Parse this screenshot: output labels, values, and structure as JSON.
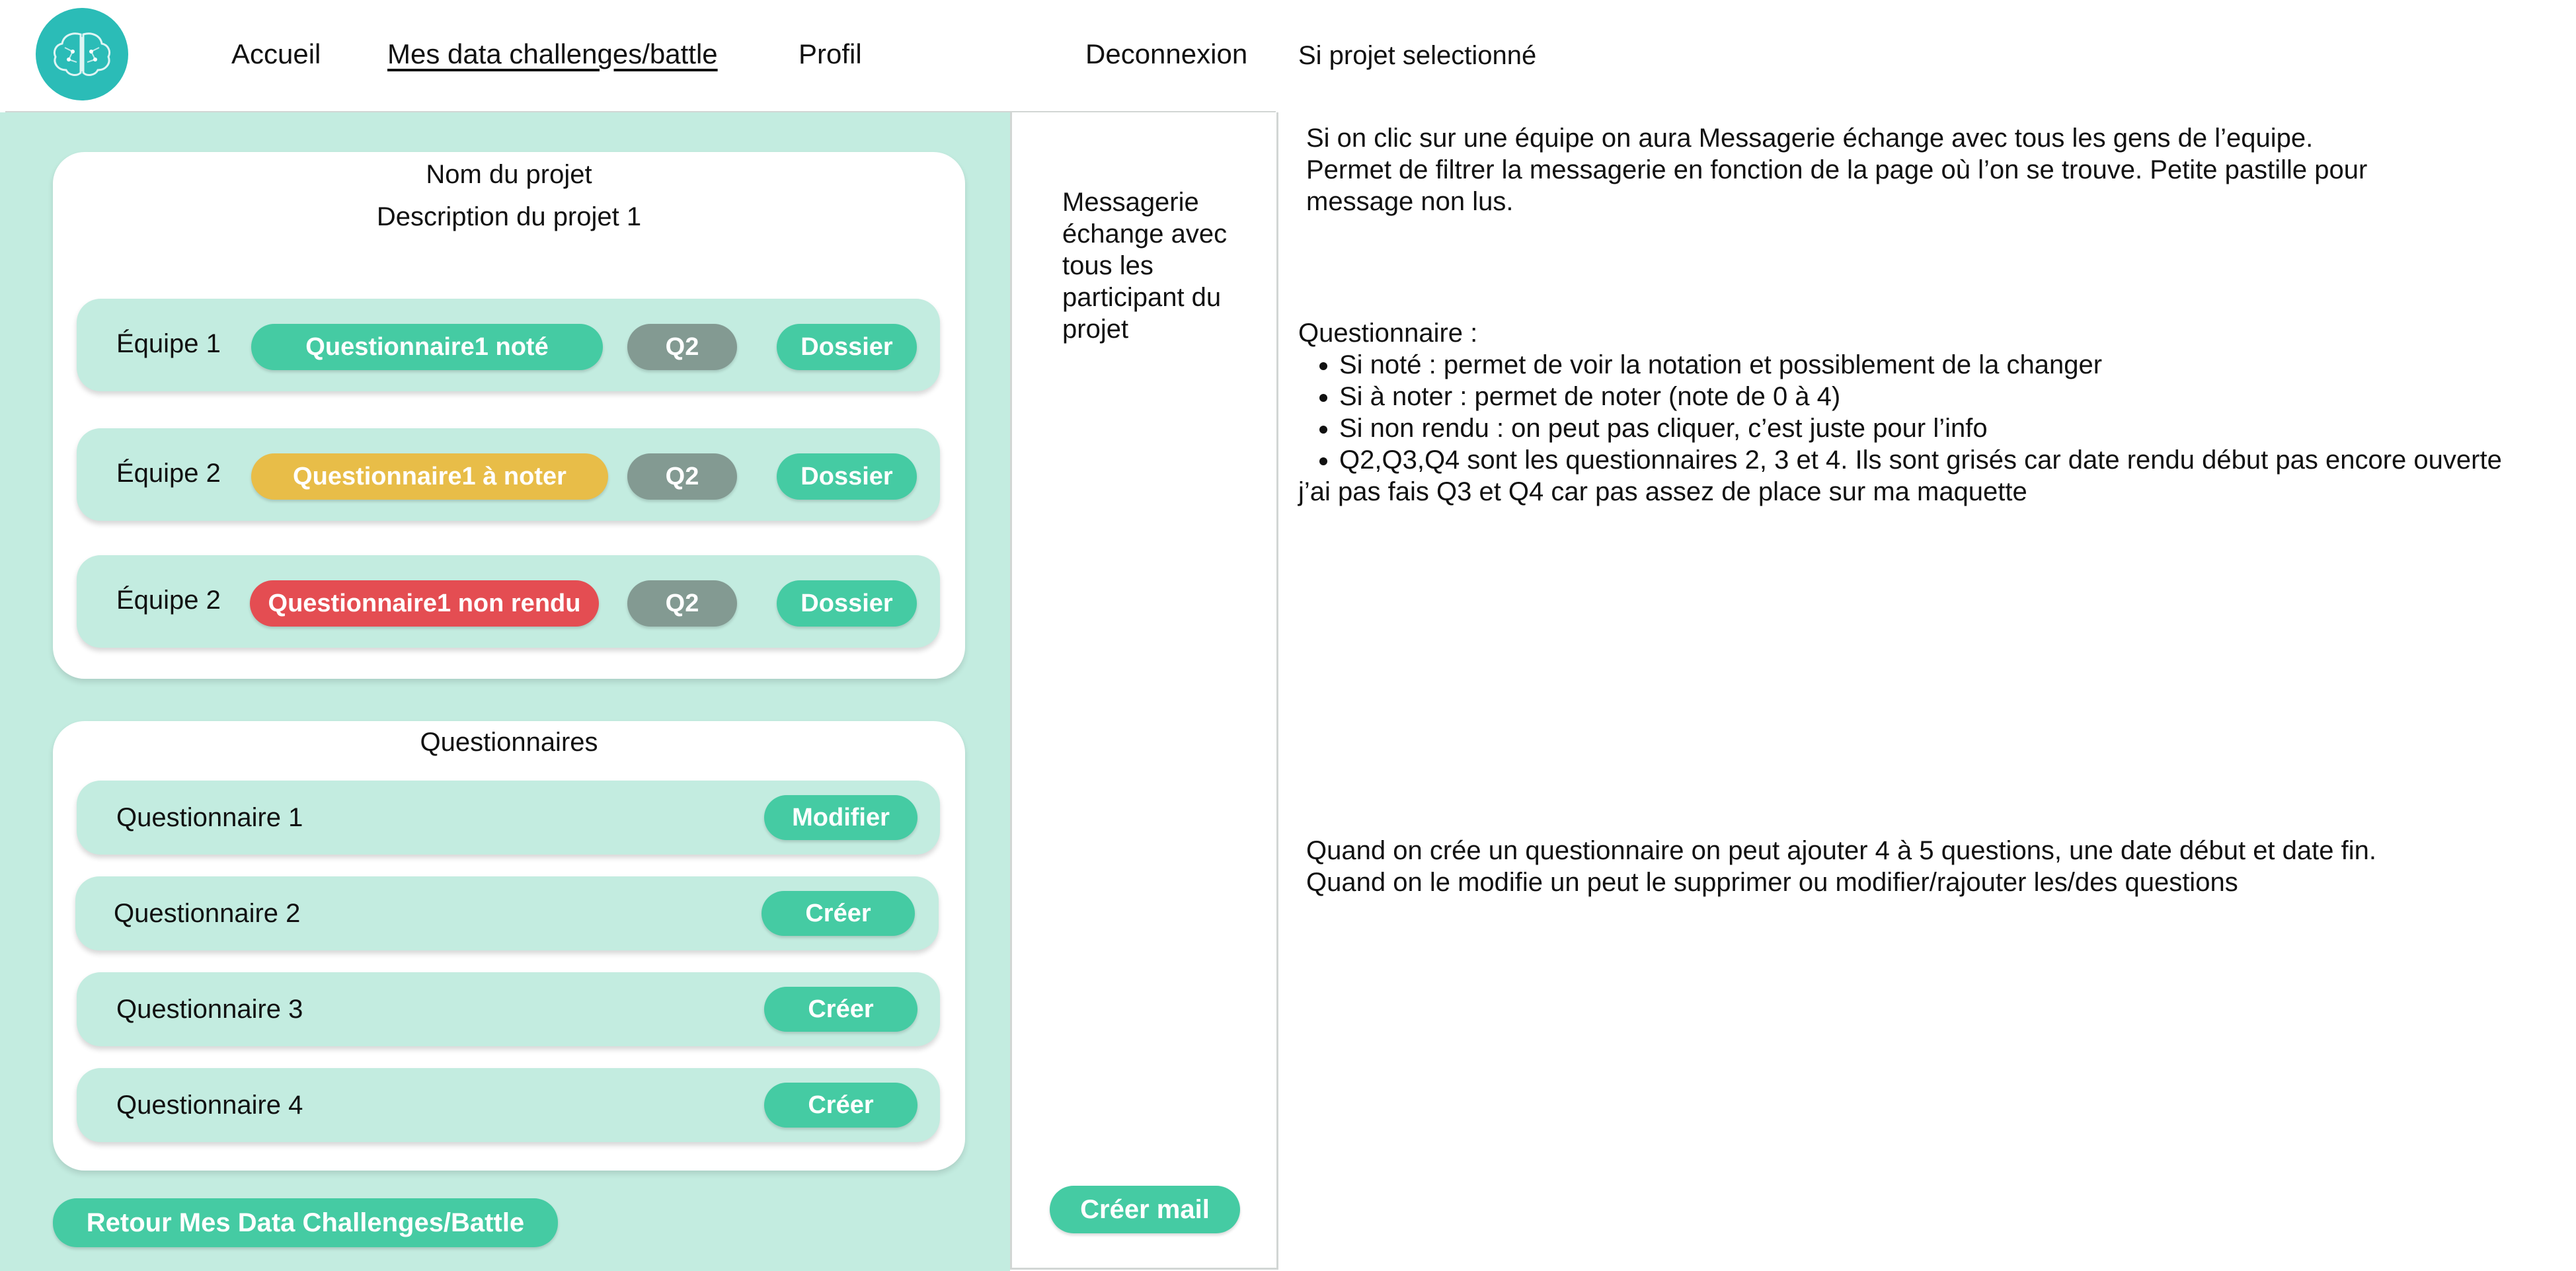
{
  "nav": {
    "home": "Accueil",
    "challenges": "Mes data challenges/battle",
    "profile": "Profil",
    "logout": "Deconnexion"
  },
  "project": {
    "name": "Nom du projet",
    "description": "Description du projet 1"
  },
  "teams": [
    {
      "label": "Équipe 1",
      "q1": "Questionnaire1 noté",
      "q1_status": "noted",
      "q2": "Q2",
      "folder": "Dossier"
    },
    {
      "label": "Équipe 2",
      "q1": "Questionnaire1 à noter",
      "q1_status": "to-grade",
      "q2": "Q2",
      "folder": "Dossier"
    },
    {
      "label": "Équipe 2",
      "q1": "Questionnaire1 non rendu",
      "q1_status": "not-submitted",
      "q2": "Q2",
      "folder": "Dossier"
    }
  ],
  "questionnaires": {
    "title": "Questionnaires",
    "items": [
      {
        "label": "Questionnaire 1",
        "action": "Modifier"
      },
      {
        "label": "Questionnaire 2",
        "action": "Créer"
      },
      {
        "label": "Questionnaire 3",
        "action": "Créer"
      },
      {
        "label": "Questionnaire 4",
        "action": "Créer"
      }
    ]
  },
  "back_button": "Retour Mes Data Challenges/Battle",
  "messaging": {
    "text": "Messagerie échange avec tous les participant du projet",
    "create_mail": "Créer mail"
  },
  "annotations": {
    "title": "Si projet selectionné",
    "messaging_note": [
      "Si on clic sur une équipe on aura Messagerie  échange avec tous les gens de l’equipe.",
      "Permet de filtrer la messagerie en fonction de la page où l’on se trouve. Petite pastille pour",
      "message non lus."
    ],
    "questionnaire_heading": "Questionnaire :",
    "questionnaire_bullets": [
      "Si noté : permet de voir la notation et possiblement de la changer",
      "Si à noter : permet de noter (note de 0 à 4)",
      "Si non rendu : on peut pas cliquer, c’est juste pour l’info",
      "Q2,Q3,Q4 sont les questionnaires 2, 3 et 4. Ils sont grisés car date rendu début pas encore ouverte"
    ],
    "questionnaire_footer": "j’ai pas fais Q3 et Q4 car pas assez de place sur ma maquette",
    "creation_note": [
      "Quand on crée un questionnaire on peut ajouter 4 à 5 questions, une date début et date fin.",
      "Quand on le modifie un peut le supprimer ou modifier/rajouter les/des questions"
    ]
  },
  "colors": {
    "brand_teal": "#2bbcb7",
    "panel_mint": "#c3ece0",
    "button_green": "#45cba3",
    "status_yellow": "#e8bd48",
    "status_red": "#e44d52",
    "disabled_grey": "#839a92"
  },
  "icons": {
    "logo": "brain-icon"
  }
}
